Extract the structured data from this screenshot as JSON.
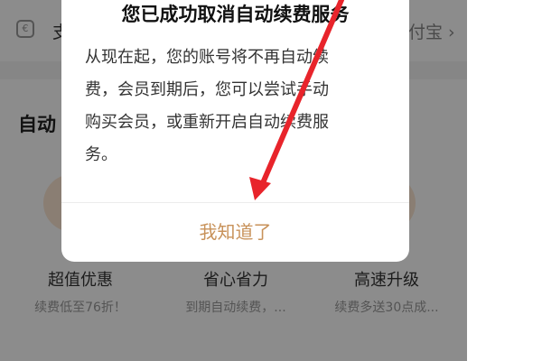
{
  "background": {
    "payment_row": {
      "label": "支",
      "right_text": "付宝 ›",
      "icon": "wallet-icon"
    },
    "section_title": "自动",
    "features": [
      {
        "title": "超值优惠",
        "desc": "续费低至76折！"
      },
      {
        "title": "省心省力",
        "desc": "到期自动续费，..."
      },
      {
        "title": "高速升级",
        "desc": "续费多送30点成..."
      }
    ]
  },
  "dialog": {
    "title": "您已成功取消自动续费服务",
    "body_lines": [
      "从现在起，您的账号将不再自动续",
      "费，会员到期后，您可以尝试手动",
      "购买会员，或重新开启自动续费服",
      "务。"
    ],
    "confirm_label": "我知道了"
  },
  "colors": {
    "accent": "#c8925a",
    "annotation_arrow": "#e8242b",
    "overlay": "rgba(0,0,0,0.45)"
  }
}
